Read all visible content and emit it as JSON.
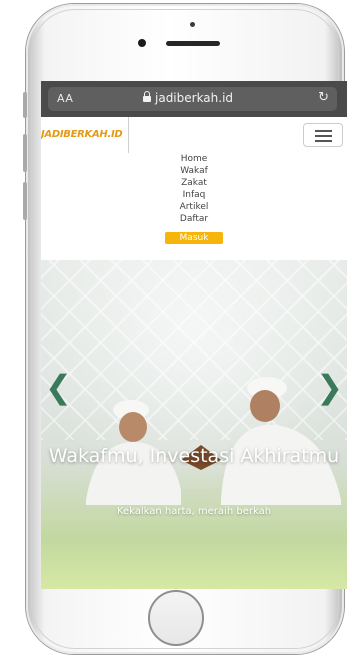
{
  "browser": {
    "text_size_label": "AA",
    "url": "jadiberkah.id",
    "reload_icon": "reload-icon",
    "lock_icon": "lock-icon"
  },
  "header": {
    "logo_text": "JADIBERKAH.ID",
    "menu_toggle_icon": "hamburger-icon"
  },
  "menu": {
    "items": [
      {
        "label": "Home",
        "active": false
      },
      {
        "label": "Wakaf",
        "active": false
      },
      {
        "label": "Zakat",
        "active": false
      },
      {
        "label": "Infaq",
        "active": false
      },
      {
        "label": "Artikel",
        "active": false
      },
      {
        "label": "Daftar",
        "active": false
      },
      {
        "label": "Masuk",
        "active": true
      }
    ]
  },
  "hero": {
    "title": "Wakafmu, Investasi Akhiratmu",
    "subtitle": "Kekalkan harta, meraih berkah",
    "prev_icon": "chevron-left-icon",
    "next_icon": "chevron-right-icon"
  },
  "colors": {
    "brand": "#e39b16",
    "active_menu": "#f5b50a",
    "arrow": "#3a7a5a",
    "url_bar": "#4a4a4a"
  }
}
